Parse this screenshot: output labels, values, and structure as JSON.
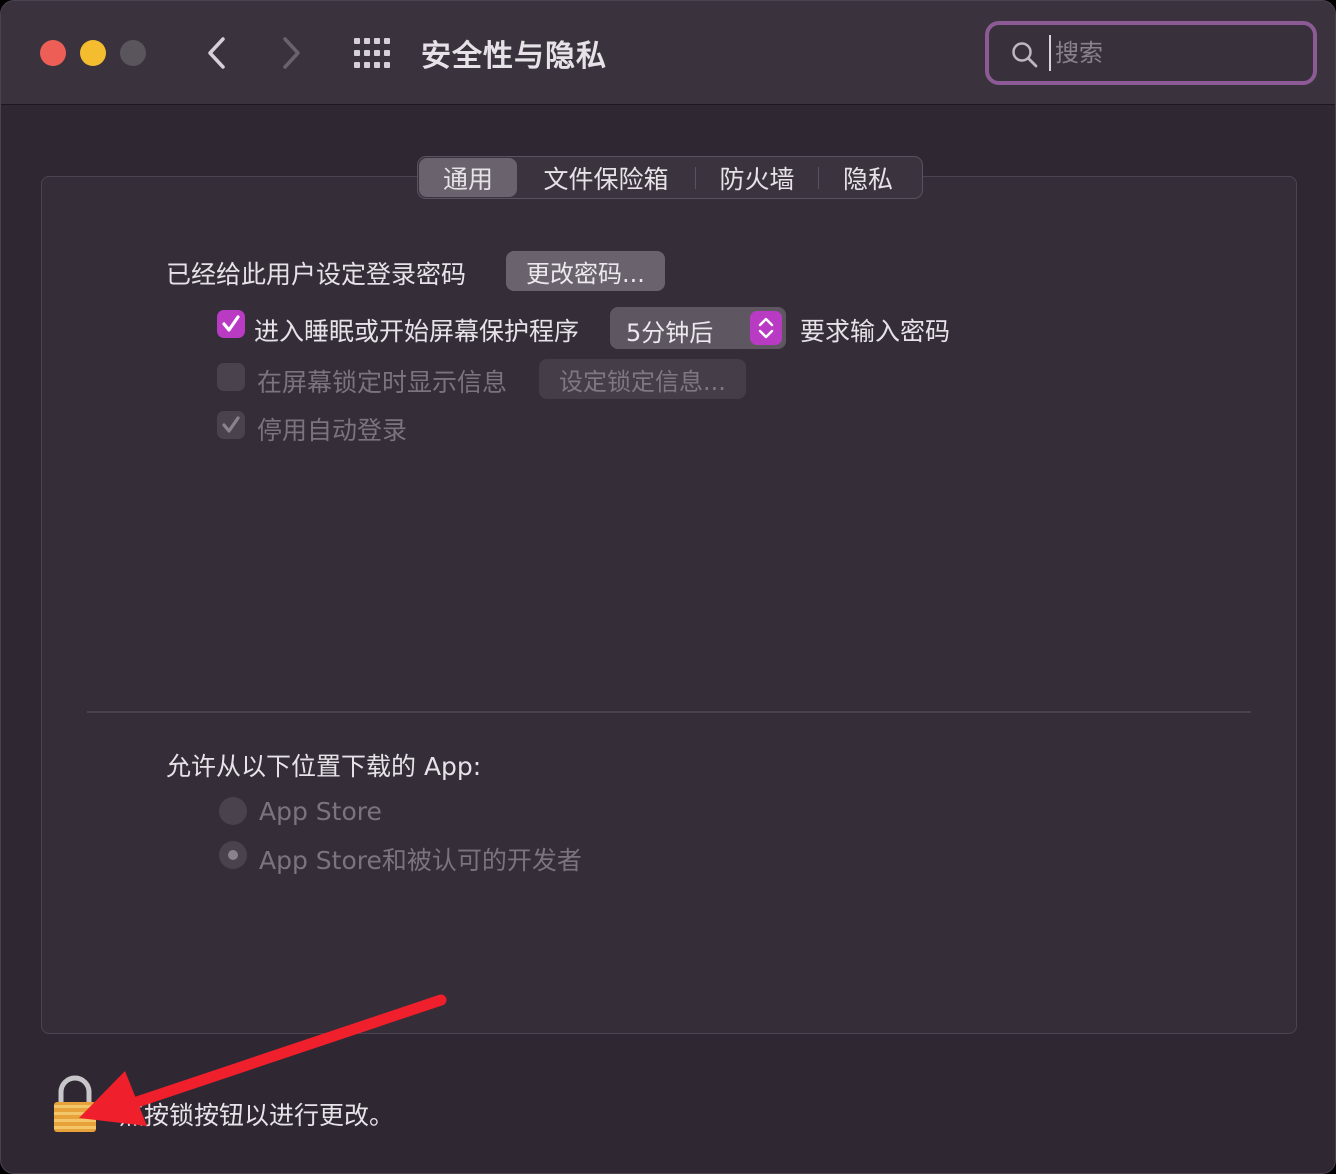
{
  "window": {
    "title": "安全性与隐私",
    "search_placeholder": "搜索"
  },
  "tabs": [
    {
      "label": "通用",
      "selected": true
    },
    {
      "label": "文件保险箱",
      "selected": false
    },
    {
      "label": "防火墙",
      "selected": false
    },
    {
      "label": "隐私",
      "selected": false
    }
  ],
  "general": {
    "password_label": "已经给此用户设定登录密码",
    "change_password_button": "更改密码...",
    "require_password": {
      "checked": true,
      "label_before": "进入睡眠或开始屏幕保护程序",
      "delay_value": "5分钟后",
      "label_after": "要求输入密码"
    },
    "lock_message": {
      "checked": false,
      "enabled": false,
      "label": "在屏幕锁定时显示信息",
      "button": "设定锁定信息..."
    },
    "disable_auto_login": {
      "checked": true,
      "enabled": false,
      "label": "停用自动登录"
    }
  },
  "downloads": {
    "label": "允许从以下位置下载的 App:",
    "options": [
      {
        "label": "App Store",
        "selected": false
      },
      {
        "label": "App Store和被认可的开发者",
        "selected": true
      }
    ]
  },
  "footer": {
    "lock_text": "点按锁按钮以进行更改。"
  },
  "colors": {
    "accent": "#b93bc4",
    "search_focus": "#8c5b95",
    "annotation_arrow": "#ef1f2b"
  },
  "icons": {
    "search": "search-icon",
    "back": "chevron-left-icon",
    "forward": "chevron-right-icon",
    "grid": "grid-icon",
    "lock": "lock-icon"
  }
}
